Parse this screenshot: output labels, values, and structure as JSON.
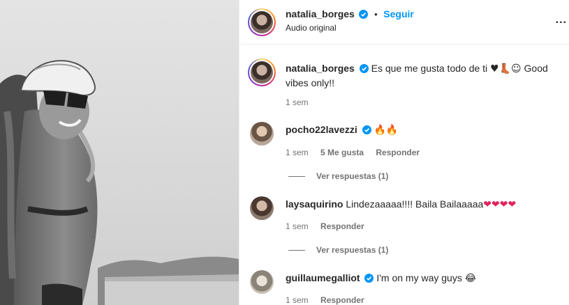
{
  "post_header": {
    "username": "natalia_borges",
    "follow_label": "Seguir",
    "dot": "•",
    "audio_label": "Audio original",
    "more_label": "..."
  },
  "caption": {
    "username": "natalia_borges",
    "text": "Es que me gusta todo de ti",
    "emojis": "♥👢☺",
    "text_end": "Good vibes only!!",
    "time": "1 sem"
  },
  "comments": [
    {
      "username": "pocho22lavezzi",
      "verified": true,
      "text": "🔥🔥",
      "time": "1 sem",
      "likes": "5 Me gusta",
      "reply_label": "Responder",
      "view_replies": "Ver respuestas (1)"
    },
    {
      "username": "laysaquirino",
      "verified": false,
      "text": "Lindezaaaaa!!!! Baila Bailaaaaa",
      "hearts": "❤❤❤❤",
      "time": "1 sem",
      "reply_label": "Responder",
      "view_replies": "Ver respuestas (1)"
    },
    {
      "username": "guillaumegalliot",
      "verified": true,
      "text": "I'm on my way guys",
      "emoji": "😂",
      "time": "1 sem",
      "reply_label": "Responder"
    }
  ],
  "colors": {
    "accent": "#0095f6",
    "muted": "#737373",
    "text": "#262626"
  }
}
